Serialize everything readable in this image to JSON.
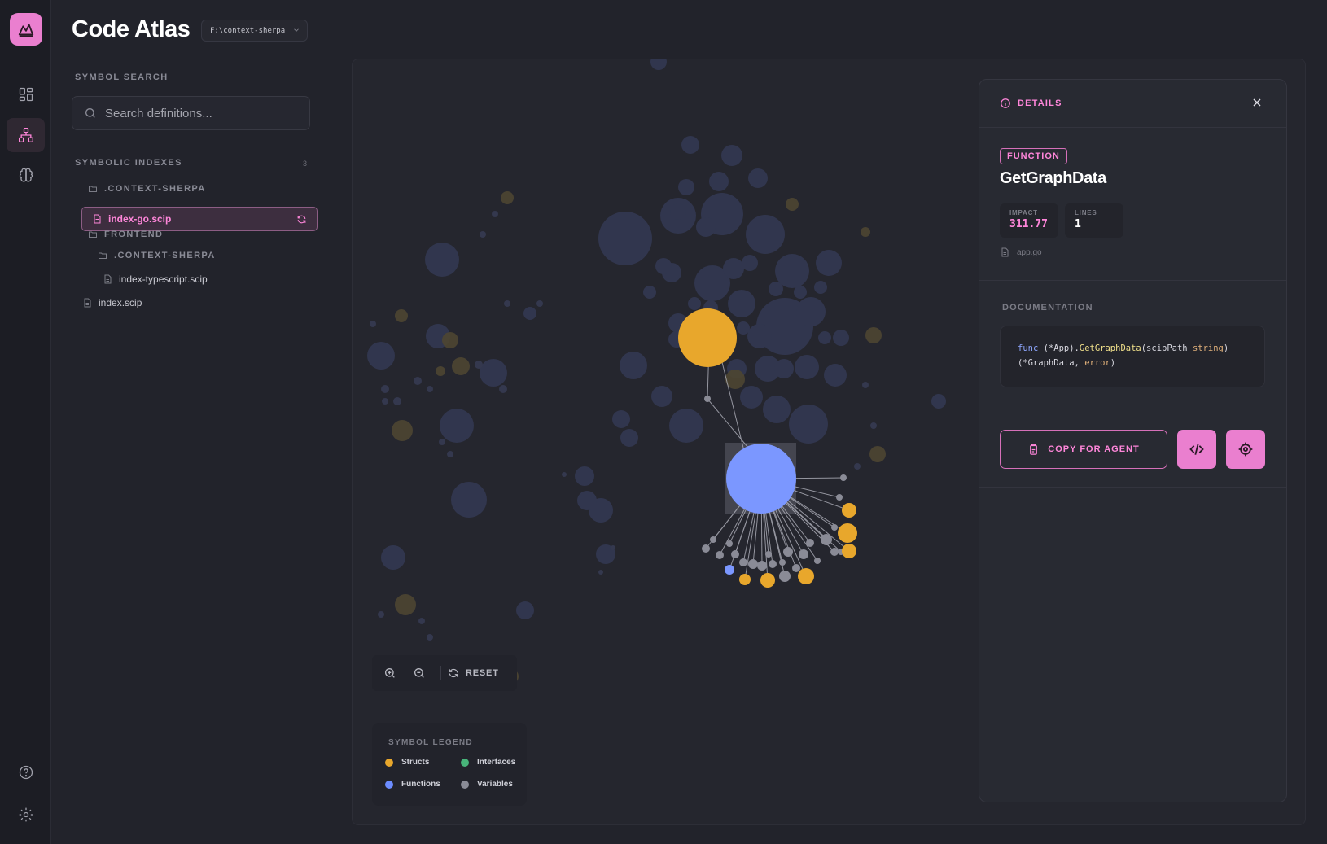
{
  "app": {
    "title": "Code Atlas",
    "workspace": "F:\\context-sherpa"
  },
  "rail": {
    "items": [
      "dashboard",
      "graph",
      "brain"
    ],
    "bottom": [
      "help",
      "settings"
    ]
  },
  "search": {
    "title": "SYMBOL SEARCH",
    "placeholder": "Search definitions..."
  },
  "indexes": {
    "title": "SYMBOLIC INDEXES",
    "count": "3",
    "tree": [
      {
        "type": "folder",
        "label": ".CONTEXT-SHERPA"
      },
      {
        "type": "file",
        "label": "index-go.scip",
        "active": true
      },
      {
        "type": "folder",
        "label": "FRONTEND"
      },
      {
        "type": "folder",
        "label": ".CONTEXT-SHERPA"
      },
      {
        "type": "file",
        "label": "index-typescript.scip"
      },
      {
        "type": "file",
        "label": "index.scip"
      }
    ]
  },
  "controls": {
    "reset": "RESET"
  },
  "legend": {
    "title": "SYMBOL LEGEND",
    "items": [
      {
        "label": "Structs",
        "color": "#e8a72c"
      },
      {
        "label": "Interfaces",
        "color": "#48b47a"
      },
      {
        "label": "Functions",
        "color": "#6c8cff"
      },
      {
        "label": "Variables",
        "color": "#8a8b96"
      }
    ]
  },
  "details": {
    "title": "DETAILS",
    "kind": "FUNCTION",
    "name": "GetGraphData",
    "impact_label": "IMPACT",
    "impact": "311.77",
    "lines_label": "LINES",
    "lines": "1",
    "file": "app.go",
    "doc_title": "DOCUMENTATION",
    "code": {
      "kw": "func",
      "recv": " (*App).",
      "fn": "GetGraphData",
      "args1": "(scipPath ",
      "ty1": "string",
      "args2": ")",
      "line2a": "(*GraphData, ",
      "ty2": "error",
      "line2b": ")"
    },
    "copy_label": "COPY FOR AGENT"
  },
  "colors": {
    "accent": "#ea7fcf",
    "struct": "#e8a72c",
    "function": "#7b97ff",
    "variable": "#8a8b96"
  }
}
